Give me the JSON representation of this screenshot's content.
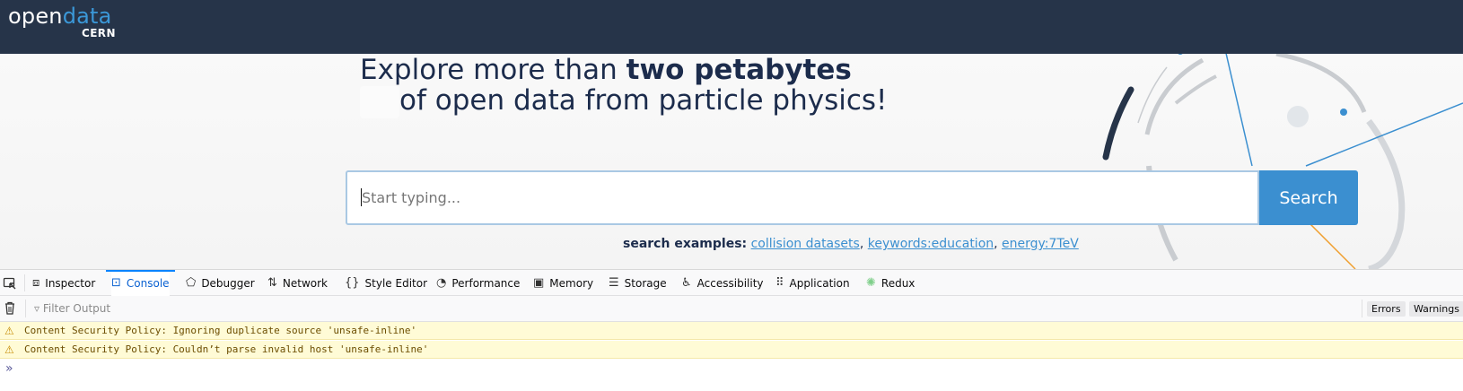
{
  "header": {
    "logo_word_1": "open",
    "logo_word_2": "data",
    "logo_sub": "CERN"
  },
  "hero": {
    "line1_prefix": "Explore more than ",
    "line1_bold": "two petabytes",
    "line2": "of open data from particle physics!"
  },
  "search": {
    "placeholder": "Start typing...",
    "button_label": "Search",
    "examples_label": "search examples:",
    "examples": [
      "collision datasets",
      "keywords:education",
      "energy:7TeV"
    ],
    "separator": ", "
  },
  "devtools": {
    "tabs": [
      {
        "label": "Inspector",
        "icon": "inspector-icon"
      },
      {
        "label": "Console",
        "icon": "console-icon",
        "active": true
      },
      {
        "label": "Debugger",
        "icon": "debugger-icon"
      },
      {
        "label": "Network",
        "icon": "network-icon"
      },
      {
        "label": "Style Editor",
        "icon": "style-editor-icon"
      },
      {
        "label": "Performance",
        "icon": "performance-icon"
      },
      {
        "label": "Memory",
        "icon": "memory-icon"
      },
      {
        "label": "Storage",
        "icon": "storage-icon"
      },
      {
        "label": "Accessibility",
        "icon": "accessibility-icon"
      },
      {
        "label": "Application",
        "icon": "application-icon"
      },
      {
        "label": "Redux",
        "icon": "redux-icon"
      }
    ],
    "filter_placeholder": "Filter Output",
    "filter_buttons": [
      "Errors",
      "Warnings"
    ],
    "messages": [
      "Content Security Policy: Ignoring duplicate source 'unsafe-inline'",
      "Content Security Policy: Couldn’t parse invalid host 'unsafe-inline'"
    ]
  },
  "colors": {
    "header_bg": "#263449",
    "brand_blue": "#3b98d8",
    "heading": "#1c2c4c",
    "warning_bg": "#fffbd6"
  }
}
